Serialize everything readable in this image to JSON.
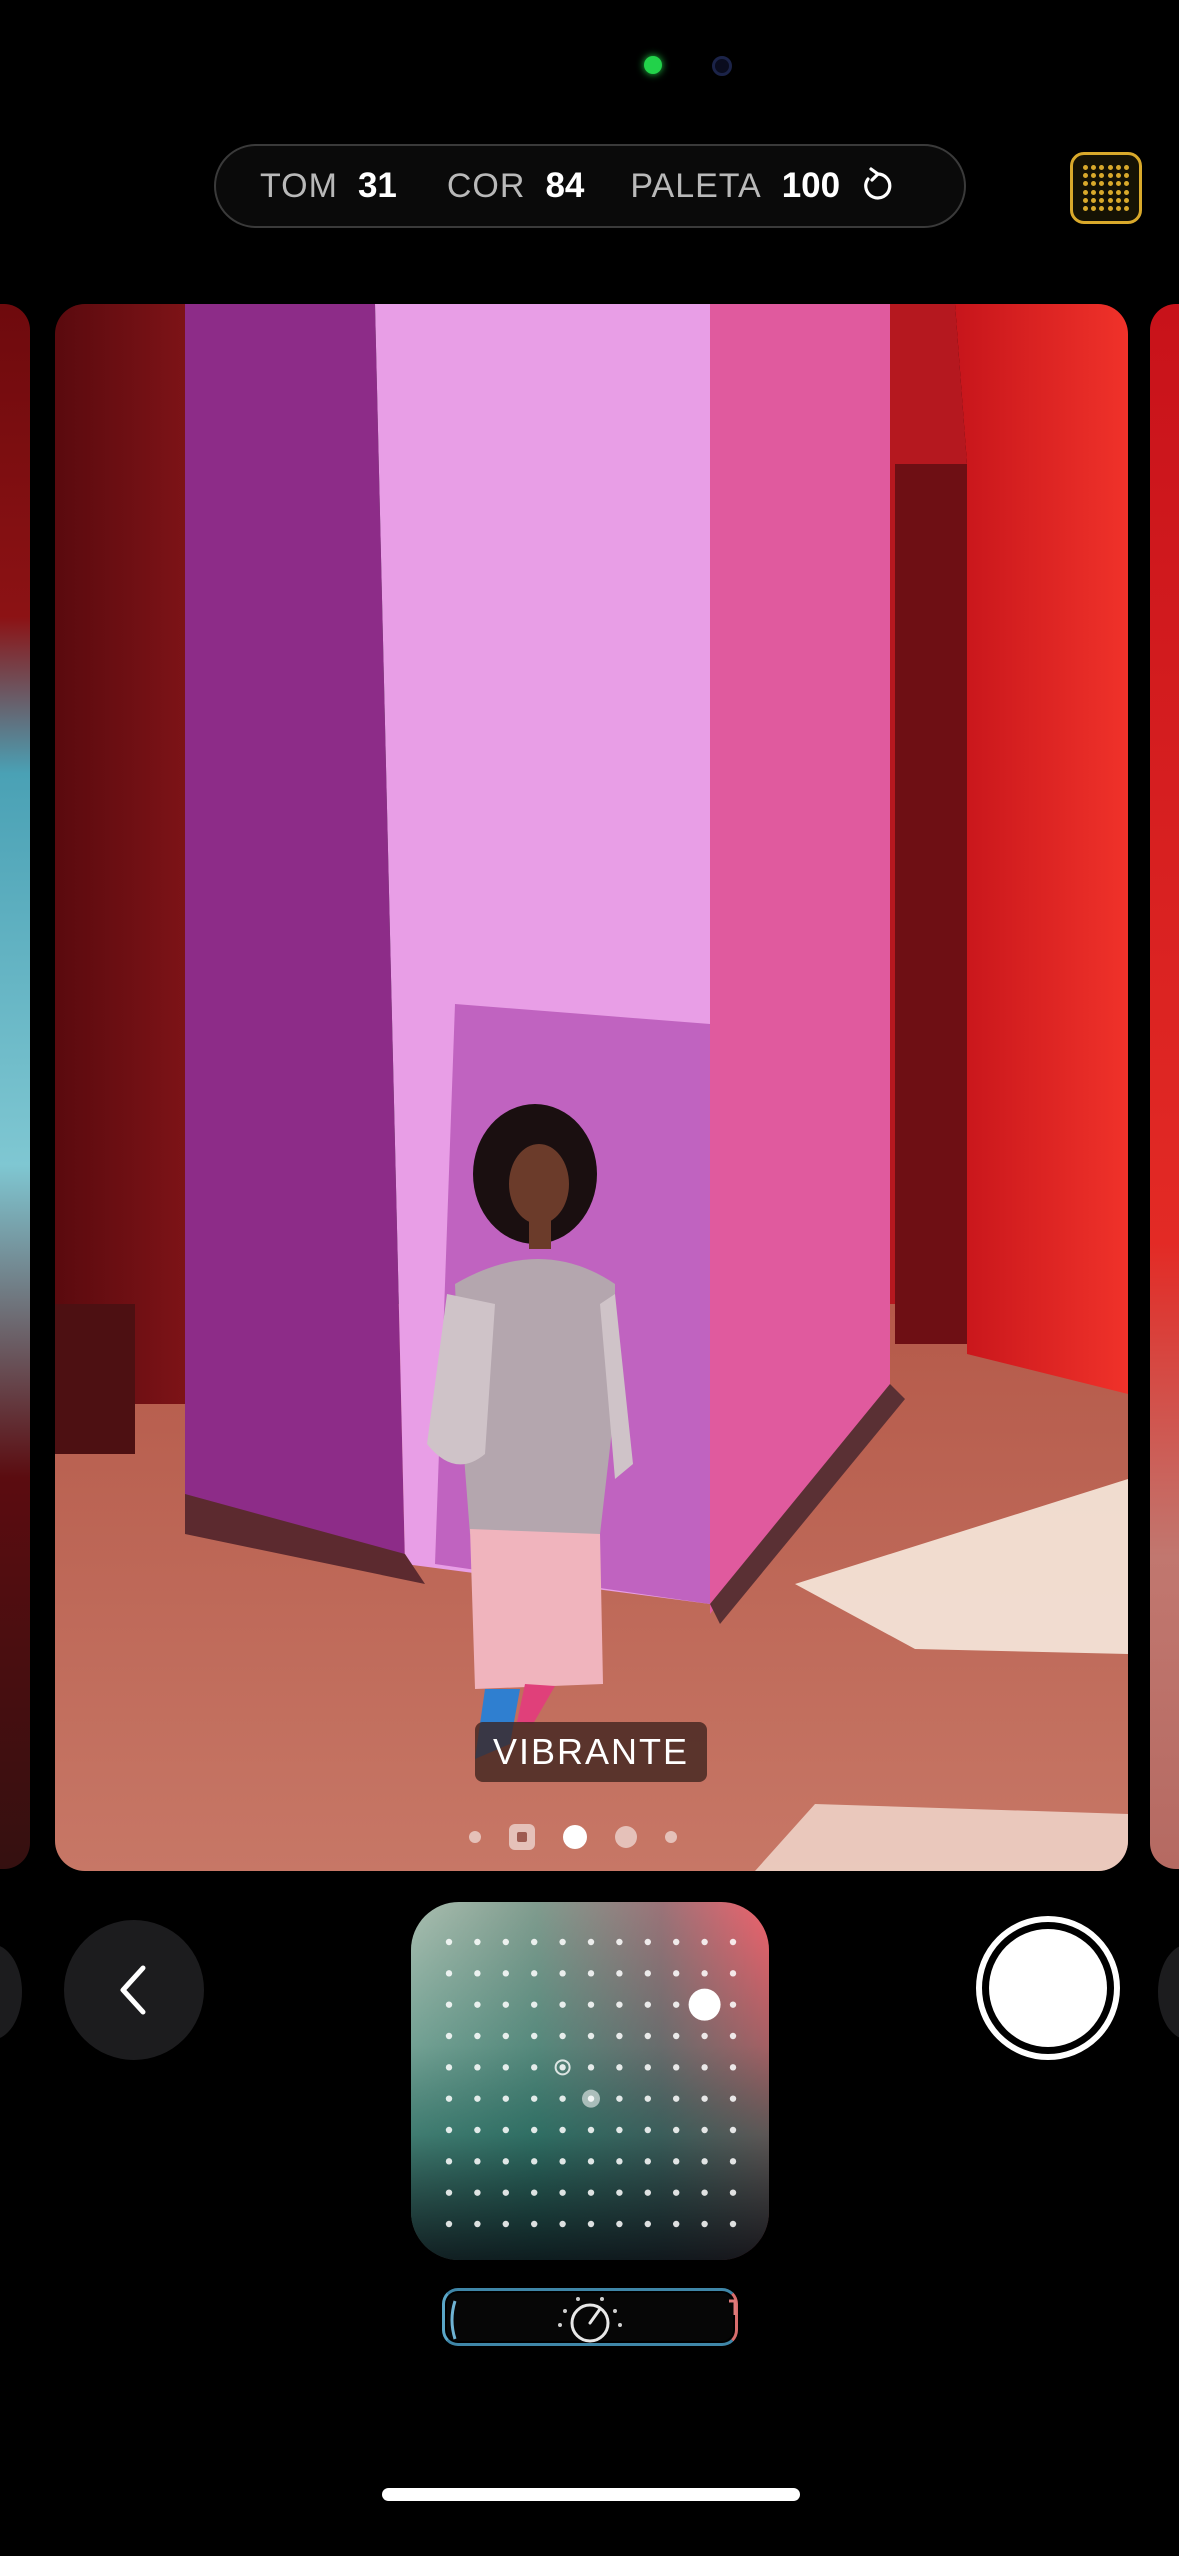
{
  "style_bar": {
    "tone_label": "TOM",
    "tone_value": "31",
    "color_label": "COR",
    "color_value": "84",
    "palette_label": "PALETA",
    "palette_value": "100"
  },
  "photo": {
    "style_name": "VIBRANTE",
    "pager": {
      "count": 5,
      "current_index": 2
    }
  },
  "controls": {
    "pad_selected_dot": {
      "column_fraction": 0.89,
      "row_fraction": 0.18
    },
    "slider_value_fraction": 0.5
  },
  "colors": {
    "accent_yellow": "#d9a92b",
    "indicator_green": "#22d24a"
  },
  "icons": {
    "reset": "reset-arrow-icon",
    "grid": "grid-dots-icon",
    "back": "chevron-left-icon",
    "shutter": "shutter-icon",
    "slider": "dial-icon"
  }
}
